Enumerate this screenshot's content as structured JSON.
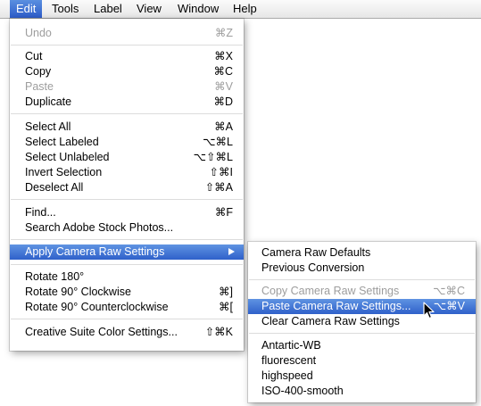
{
  "menubar": {
    "items": [
      "Edit",
      "Tools",
      "Label",
      "View",
      "Window",
      "Help"
    ],
    "active": "Edit"
  },
  "edit_menu": {
    "undo": {
      "label": "Undo",
      "shortcut": "⌘Z",
      "disabled": true
    },
    "cut": {
      "label": "Cut",
      "shortcut": "⌘X"
    },
    "copy": {
      "label": "Copy",
      "shortcut": "⌘C"
    },
    "paste": {
      "label": "Paste",
      "shortcut": "⌘V",
      "disabled": true
    },
    "duplicate": {
      "label": "Duplicate",
      "shortcut": "⌘D"
    },
    "select_all": {
      "label": "Select All",
      "shortcut": "⌘A"
    },
    "select_labeled": {
      "label": "Select Labeled",
      "shortcut": "⌥⌘L"
    },
    "select_unlabeled": {
      "label": "Select Unlabeled",
      "shortcut": "⌥⇧⌘L"
    },
    "invert_selection": {
      "label": "Invert Selection",
      "shortcut": "⇧⌘I"
    },
    "deselect_all": {
      "label": "Deselect All",
      "shortcut": "⇧⌘A"
    },
    "find": {
      "label": "Find...",
      "shortcut": "⌘F"
    },
    "search_stock": {
      "label": "Search Adobe Stock Photos..."
    },
    "apply_camera_raw": {
      "label": "Apply Camera Raw Settings",
      "selected": true,
      "submenu": true
    },
    "rotate_180": {
      "label": "Rotate 180°"
    },
    "rotate_cw": {
      "label": "Rotate 90° Clockwise",
      "shortcut": "⌘]"
    },
    "rotate_ccw": {
      "label": "Rotate 90° Counterclockwise",
      "shortcut": "⌘["
    },
    "creative_suite": {
      "label": "Creative Suite Color Settings...",
      "shortcut": "⇧⌘K"
    }
  },
  "camera_raw_submenu": {
    "defaults": {
      "label": "Camera Raw Defaults"
    },
    "previous": {
      "label": "Previous Conversion"
    },
    "copy_settings": {
      "label": "Copy Camera Raw Settings",
      "shortcut": "⌥⌘C",
      "disabled": true
    },
    "paste_settings": {
      "label": "Paste Camera Raw Settings...",
      "shortcut": "⌥⌘V",
      "selected": true
    },
    "clear_settings": {
      "label": "Clear Camera Raw Settings"
    },
    "presets": [
      "Antartic-WB",
      "fluorescent",
      "highspeed",
      "ISO-400-smooth"
    ]
  },
  "colors": {
    "highlight": "#3a6fd6",
    "disabled_text": "#9d9d9d"
  }
}
